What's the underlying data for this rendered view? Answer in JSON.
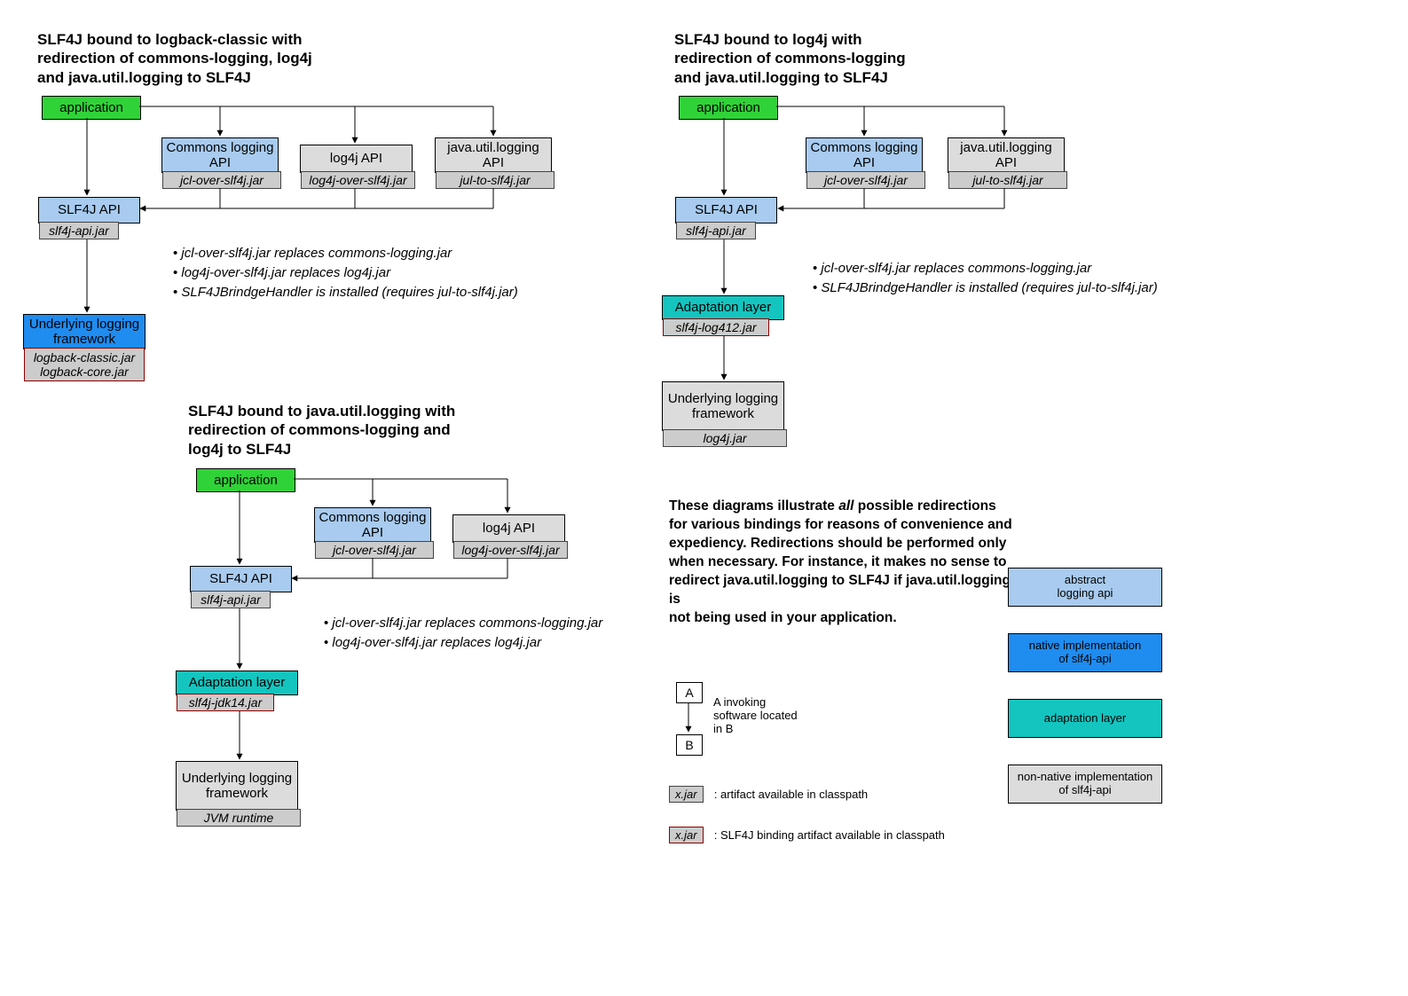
{
  "colors": {
    "green": "#2fd337",
    "lightblue": "#a8cbef",
    "blue": "#1f8cf0",
    "teal": "#14c5bf",
    "grey": "#dcdcdc",
    "jar": "#cccccc"
  },
  "d1": {
    "title": "SLF4J bound to logback-classic with\nredirection of commons-logging, log4j\nand java.util.logging to SLF4J",
    "app": "application",
    "commons": "Commons logging API",
    "commons_jar": "jcl-over-slf4j.jar",
    "log4j": "log4j API",
    "log4j_jar": "log4j-over-slf4j.jar",
    "jul": "java.util.logging API",
    "jul_jar": "jul-to-slf4j.jar",
    "slf4j": "SLF4J API",
    "slf4j_jar": "slf4j-api.jar",
    "ul": "Underlying logging framework",
    "ul_jar": "logback-classic.jar\nlogback-core.jar",
    "bullets": [
      "jcl-over-slf4j.jar replaces commons-logging.jar",
      "log4j-over-slf4j.jar replaces log4j.jar",
      "SLF4JBrindgeHandler is installed (requires jul-to-slf4j.jar)"
    ]
  },
  "d2": {
    "title": "SLF4J bound to java.util.logging with\nredirection of commons-logging and\nlog4j to SLF4J",
    "app": "application",
    "commons": "Commons logging API",
    "commons_jar": "jcl-over-slf4j.jar",
    "log4j": "log4j API",
    "log4j_jar": "log4j-over-slf4j.jar",
    "slf4j": "SLF4J API",
    "slf4j_jar": "slf4j-api.jar",
    "adapt": "Adaptation layer",
    "adapt_jar": "slf4j-jdk14.jar",
    "ul": "Underlying logging framework",
    "ul_jar": "JVM runtime",
    "bullets": [
      "jcl-over-slf4j.jar replaces commons-logging.jar",
      "log4j-over-slf4j.jar replaces log4j.jar"
    ]
  },
  "d3": {
    "title": "SLF4J bound to log4j with\nredirection of commons-logging\nand java.util.logging to SLF4J",
    "app": "application",
    "commons": "Commons logging API",
    "commons_jar": "jcl-over-slf4j.jar",
    "jul": "java.util.logging API",
    "jul_jar": "jul-to-slf4j.jar",
    "slf4j": "SLF4J API",
    "slf4j_jar": "slf4j-api.jar",
    "adapt": "Adaptation layer",
    "adapt_jar": "slf4j-log412.jar",
    "ul": "Underlying logging framework",
    "ul_jar": "log4j.jar",
    "bullets": [
      "jcl-over-slf4j.jar replaces commons-logging.jar",
      "SLF4JBrindgeHandler is installed (requires jul-to-slf4j.jar)"
    ]
  },
  "explain": "These diagrams illustrate all possible redirections for various bindings for reasons of convenience and expediency. Redirections should be performed only when necessary. For instance, it makes no sense to redirect java.util.logging to SLF4J if java.util.logging is\nnot being used in your application.",
  "legend": {
    "ab": "A invoking\nsoftware located\nin B",
    "xjar": "x.jar",
    "xjar_txt": ": artifact available in classpath",
    "xjar2": "x.jar",
    "xjar2_txt": ": SLF4J binding artifact available in classpath",
    "abs": "abstract\nlogging api",
    "nat": "native implementation\nof slf4j-api",
    "adp": "adaptation layer",
    "non": "non-native implementation\nof slf4j-api",
    "A": "A",
    "B": "B"
  }
}
